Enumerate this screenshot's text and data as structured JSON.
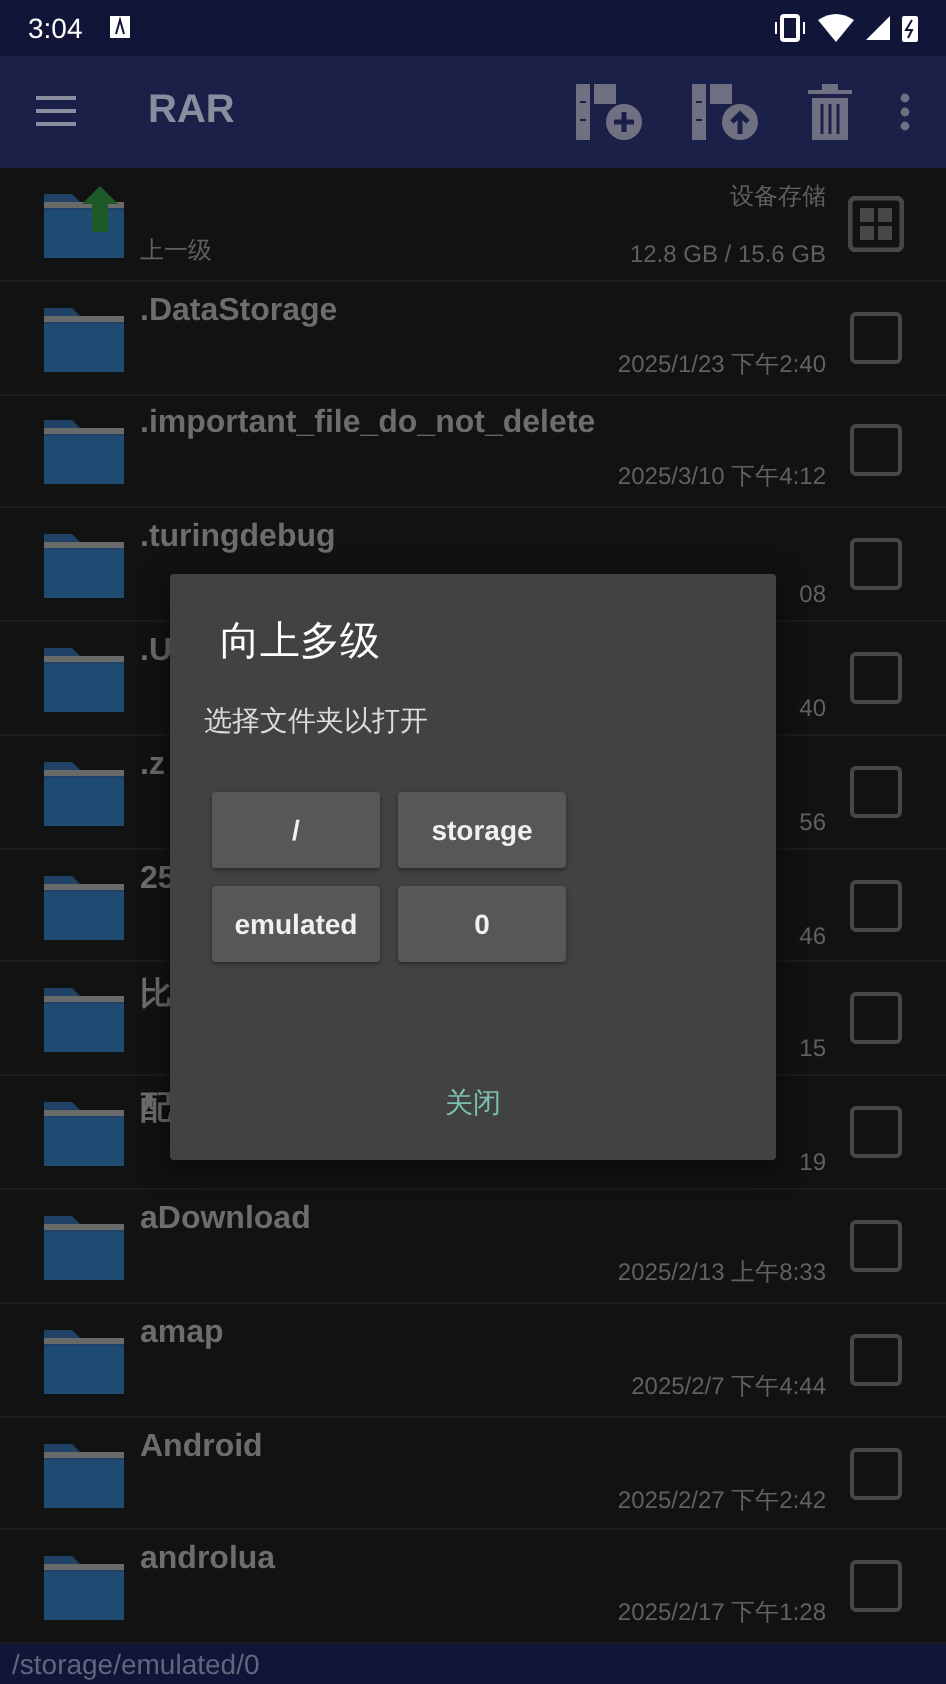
{
  "status_bar": {
    "time": "3:04"
  },
  "app_bar": {
    "title": "RAR"
  },
  "parent_row": {
    "label": "上一级",
    "storage_name": "设备存储",
    "storage_size": "12.8 GB / 15.6 GB"
  },
  "folders": [
    {
      "name": ".DataStorage",
      "date": "2025/1/23 下午2:40",
      "checked": false
    },
    {
      "name": ".important_file_do_not_delete",
      "date": "2025/3/10 下午4:12",
      "checked": false
    },
    {
      "name": ".turingdebug",
      "date": "08",
      "checked": false
    },
    {
      "name": ".U",
      "date": "40",
      "checked": false
    },
    {
      "name": ".z",
      "date": "56",
      "checked": false
    },
    {
      "name": "25",
      "date": "46",
      "checked": false
    },
    {
      "name": "比",
      "date": "15",
      "checked": false
    },
    {
      "name": "配",
      "date": "19",
      "checked": false
    },
    {
      "name": "aDownload",
      "date": "2025/2/13 上午8:33",
      "checked": false
    },
    {
      "name": "amap",
      "date": "2025/2/7 下午4:44",
      "checked": false
    },
    {
      "name": "Android",
      "date": "2025/2/27 下午2:42",
      "checked": false
    },
    {
      "name": "androlua",
      "date": "2025/2/17 下午1:28",
      "checked": false
    }
  ],
  "path_bar": "/storage/emulated/0",
  "dialog": {
    "title": "向上多级",
    "message": "选择文件夹以打开",
    "paths": [
      "/",
      "storage",
      "emulated",
      "0"
    ],
    "close": "关闭"
  }
}
